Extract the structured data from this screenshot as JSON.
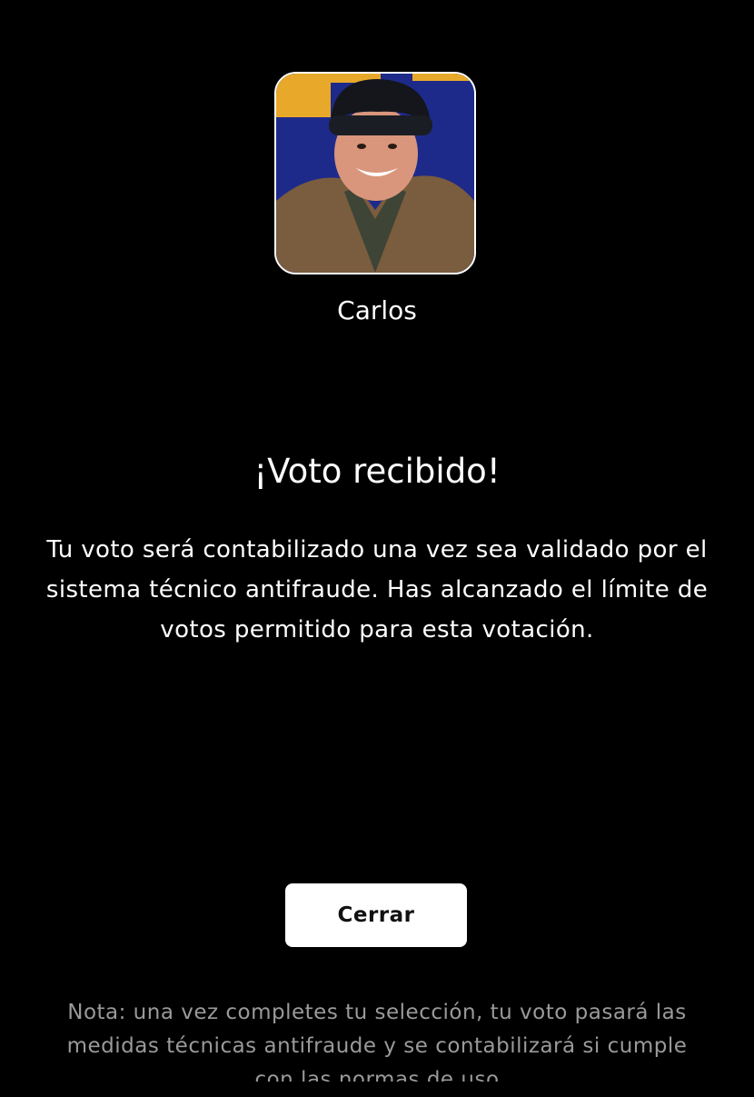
{
  "contestant": {
    "name": "Carlos",
    "photo_icon": "contestant-photo"
  },
  "result": {
    "title": "¡Voto recibido!",
    "message": "Tu voto será contabilizado una vez sea validado por el sistema técnico antifraude. Has alcanzado el límite de votos permitido para esta votación."
  },
  "actions": {
    "close_label": "Cerrar"
  },
  "footer": {
    "note": "Nota: una vez completes tu selección, tu voto pasará las medidas técnicas antifraude y se contabilizará si cumple con las normas de uso"
  },
  "colors": {
    "background": "#000000",
    "text": "#ffffff",
    "note_text": "#9a9a9a",
    "button_bg": "#ffffff",
    "avatar_bg": "#1e2a8a",
    "avatar_accent": "#e8a92a"
  }
}
